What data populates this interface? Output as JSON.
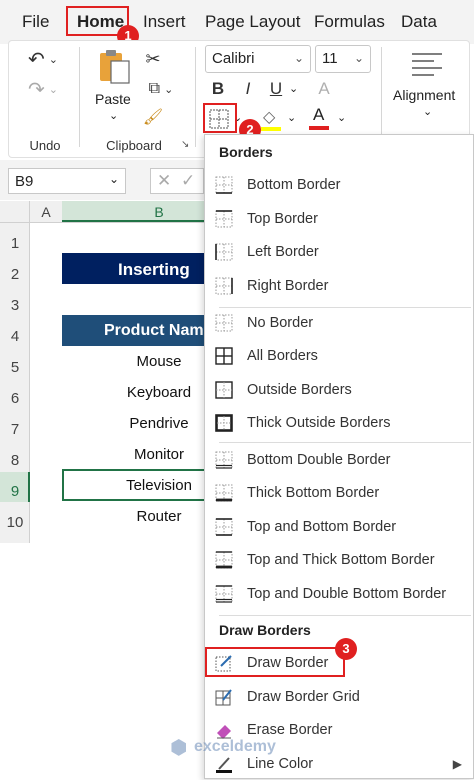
{
  "menubar": {
    "tabs": [
      "File",
      "Home",
      "Insert",
      "Page Layout",
      "Formulas",
      "Data"
    ],
    "callout_1": "1",
    "callout_2": "2",
    "callout_3": "3"
  },
  "ribbon": {
    "undo_label": "Undo",
    "paste_label": "Paste",
    "clipboard_label": "Clipboard",
    "font_name": "Calibri",
    "font_size": "11",
    "bold": "B",
    "italic": "I",
    "underline": "U",
    "font_color_letter": "A",
    "alignment_label": "Alignment"
  },
  "namebox": {
    "value": "B9"
  },
  "sheet": {
    "columns": [
      "A",
      "B"
    ],
    "rows": [
      "1",
      "2",
      "3",
      "4",
      "5",
      "6",
      "7",
      "8",
      "9",
      "10"
    ],
    "title": "Inserting",
    "header": "Product Nam",
    "items": [
      "Mouse",
      "Keyboard",
      "Pendrive",
      "Monitor",
      "Television",
      "Router"
    ]
  },
  "dropdown": {
    "borders_heading": "Borders",
    "group1": [
      "Bottom Border",
      "Top Border",
      "Left Border",
      "Right Border"
    ],
    "group2": [
      "No Border",
      "All Borders",
      "Outside Borders",
      "Thick Outside Borders"
    ],
    "group3": [
      "Bottom Double Border",
      "Thick Bottom Border",
      "Top and Bottom Border",
      "Top and Thick Bottom Border",
      "Top and Double Bottom Border"
    ],
    "draw_heading": "Draw Borders",
    "draw": [
      "Draw Border",
      "Draw Border Grid",
      "Erase Border",
      "Line Color"
    ]
  },
  "watermark": "exceldemy",
  "colors": {
    "accent_red": "#e02020",
    "title_fill": "#002060",
    "header_fill": "#1f4e79",
    "selected_border": "#217346"
  }
}
